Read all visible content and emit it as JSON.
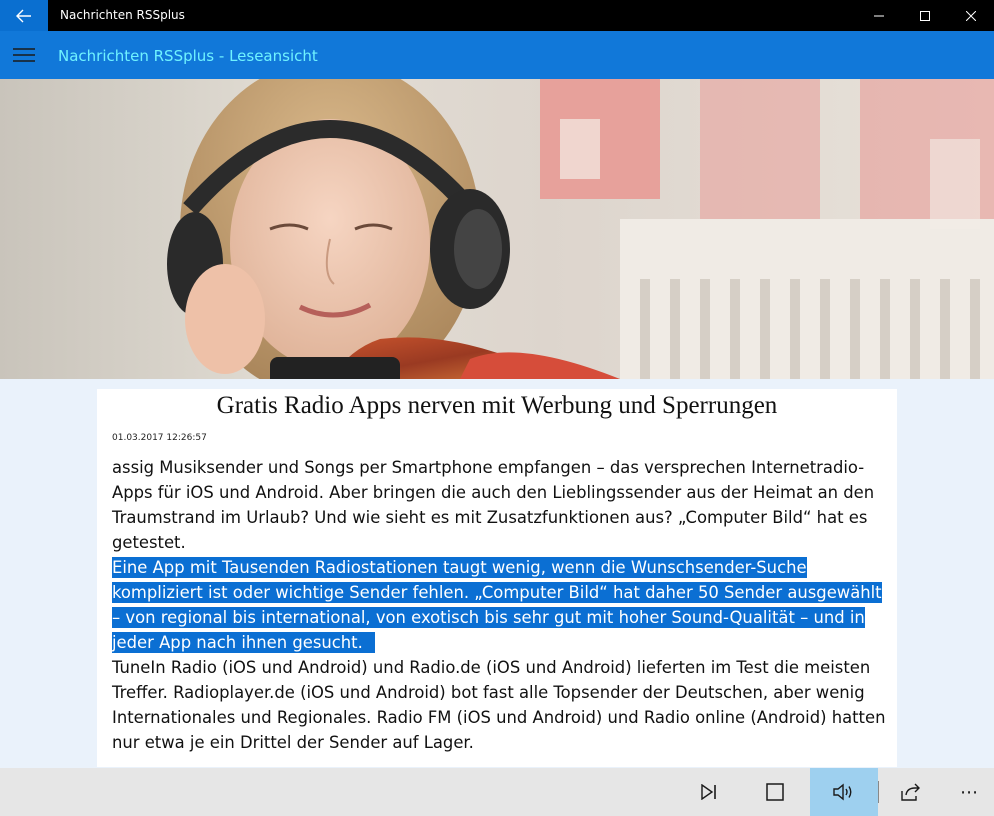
{
  "window": {
    "app_title": "Nachrichten RSSplus",
    "back_icon": "arrow-left-icon",
    "minimize_icon": "minimize-icon",
    "maximize_icon": "maximize-icon",
    "close_icon": "close-icon"
  },
  "header": {
    "title": "Nachrichten RSSplus - Leseansicht",
    "menu_icon": "hamburger-icon"
  },
  "colors": {
    "title_bar": "#000000",
    "accent": "#1178d9",
    "header_title": "#6ff2ff",
    "selection": "#0b6fd3",
    "command_bar": "#e6e6e6",
    "speak_active": "#9ed0ef"
  },
  "article": {
    "title": "Gratis Radio Apps nerven mit Werbung und Sperrungen",
    "date": "01.03.2017 12:26:57",
    "paragraph1": "assig Musiksender und Songs per Smartphone empfangen – das versprechen Internetradio-Apps für iOS und Android. Aber bringen die auch den Lieblingssender aus der Heimat an den Traumstrand im Urlaub? Und wie sieht es mit Zusatzfunktionen aus? „Computer Bild“ hat es getestet.",
    "paragraph2_highlighted": "Eine App mit Tausenden Radiostationen taugt wenig, wenn die Wunschsender-Suche kompliziert ist oder wichtige Sender fehlen. „Computer Bild“ hat daher 50 Sender ausgewählt – von regional bis international, von exotisch bis sehr gut mit hoher Sound-Qualität – und in jeder App nach ihnen gesucht.",
    "paragraph3": "TuneIn Radio (iOS und Android) und Radio.de (iOS und Android) lieferten im Test die meisten Treffer. Radioplayer.de (iOS und Android) bot fast alle Topsender der Deutschen, aber wenig Internationales und Regionales. Radio FM (iOS und Android) und Radio online (Android) hatten nur etwa je ein Drittel der Sender auf Lager."
  },
  "commandbar": {
    "next_icon": "skip-next-icon",
    "stop_icon": "stop-icon",
    "speak_icon": "speaker-icon",
    "share_icon": "share-icon",
    "more_label": "⋯"
  }
}
